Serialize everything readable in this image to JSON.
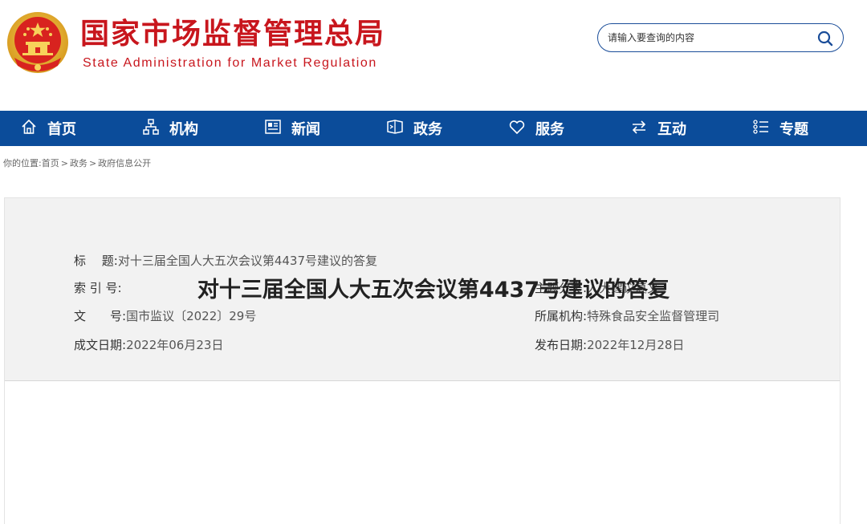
{
  "header": {
    "title_cn": "国家市场监督管理总局",
    "title_en": "State Administration for Market Regulation",
    "emblem_icon": "national-emblem-icon"
  },
  "search": {
    "placeholder": "请输入要查询的内容",
    "icon": "search-icon"
  },
  "nav": {
    "items": [
      {
        "label": "首页",
        "icon": "home-icon"
      },
      {
        "label": "机构",
        "icon": "org-chart-icon"
      },
      {
        "label": "新闻",
        "icon": "newspaper-icon"
      },
      {
        "label": "政务",
        "icon": "government-affairs-icon"
      },
      {
        "label": "服务",
        "icon": "heart-icon"
      },
      {
        "label": "互动",
        "icon": "exchange-arrows-icon"
      },
      {
        "label": "专题",
        "icon": "list-topic-icon"
      }
    ]
  },
  "breadcrumb": {
    "prefix": "你的位置:",
    "items": [
      "首页",
      "政务",
      "政府信息公开"
    ],
    "separator": ">"
  },
  "meta": {
    "title_label": "标　 题:",
    "title_value": "对十三届全国人大五次会议第4437号建议的答复",
    "index_label": "索 引 号:",
    "index_value": "",
    "topic_label": "主题分类:",
    "topic_value": "人大建议复文",
    "doc_label": "文　　号:",
    "doc_value": "国市监议〔2022〕29号",
    "org_label": "所属机构:",
    "org_value": "特殊食品安全监督管理司",
    "created_label": "成文日期:",
    "created_value": "2022年06月23日",
    "published_label": "发布日期:",
    "published_value": "2022年12月28日"
  },
  "article": {
    "title": "对十三届全国人大五次会议第4437号建议的答复"
  },
  "colors": {
    "brand_red": "#c8161d",
    "nav_blue": "#0b4c9a",
    "search_border": "#1a4d99"
  }
}
